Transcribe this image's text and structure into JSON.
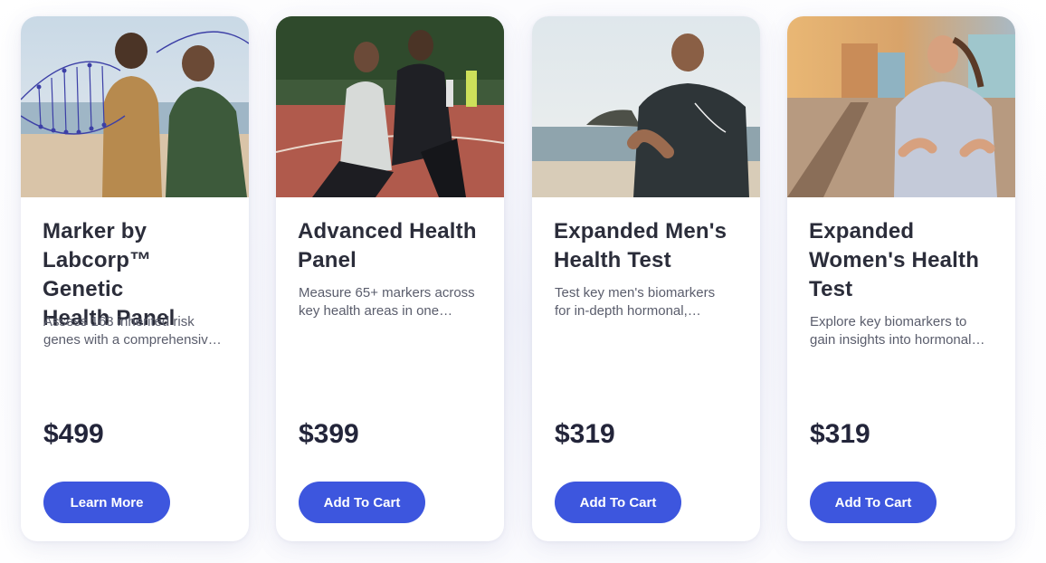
{
  "products": [
    {
      "title_lines": [
        "Marker by",
        "Labcorp™ Genetic",
        "Health Panel"
      ],
      "desc_lines": [
        "Assess 163 inherited risk",
        "genes with a comprehensiv…"
      ],
      "price": "$499",
      "button_label": "Learn More",
      "image": "two-men-walking-on-beach-with-dna-overlay"
    },
    {
      "title_lines": [
        "Advanced Health",
        "Panel"
      ],
      "desc_lines": [
        "Measure 65+ markers across",
        "key health areas in one…"
      ],
      "price": "$399",
      "button_label": "Add To Cart",
      "image": "couple-stretching-on-running-track"
    },
    {
      "title_lines": [
        "Expanded Men's",
        "Health Test"
      ],
      "desc_lines": [
        "Test key men's biomarkers",
        "for in-depth hormonal,…"
      ],
      "price": "$319",
      "button_label": "Add To Cart",
      "image": "man-jogging-on-beach"
    },
    {
      "title_lines": [
        "Expanded",
        "Women's Health",
        "Test"
      ],
      "desc_lines": [
        "Explore key biomarkers to",
        "gain insights into hormonal…"
      ],
      "price": "$319",
      "button_label": "Add To Cart",
      "image": "woman-jogging-at-sunset"
    }
  ],
  "colors": {
    "button": "#3d56de",
    "title": "#2b2d3a",
    "description": "#5a5d6c",
    "card_background": "#ffffff"
  }
}
